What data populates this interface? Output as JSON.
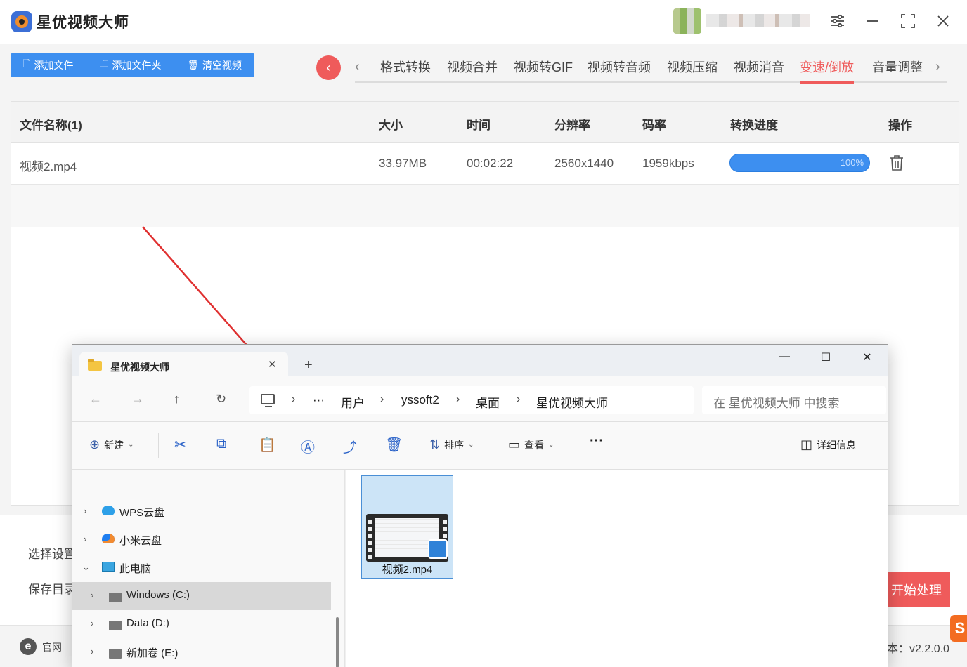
{
  "app": {
    "title": "星优视频大师",
    "toolbar": {
      "add_file": "添加文件",
      "add_folder": "添加文件夹",
      "clear_videos": "清空视频"
    },
    "tabs": [
      "格式转换",
      "视频合并",
      "视频转GIF",
      "视频转音频",
      "视频压缩",
      "视频消音",
      "变速/倒放",
      "音量调整"
    ],
    "active_tab": "变速/倒放",
    "table": {
      "headers": [
        "文件名称(1)",
        "大小",
        "时间",
        "分辨率",
        "码率",
        "转换进度",
        "操作"
      ],
      "rows": [
        {
          "name": "视频2.mp4",
          "size": "33.97MB",
          "duration": "00:02:22",
          "resolution": "2560x1440",
          "bitrate": "1959kbps",
          "progress_label": "100%",
          "progress": 100
        }
      ]
    },
    "bottom": {
      "select_settings": "选择设置",
      "save_dir": "保存目录",
      "start_button": "开始处理",
      "site_label": "官网",
      "version": "本：v2.2.0.0"
    },
    "colors": {
      "accent_blue": "#3d8ff0",
      "accent_red": "#ef5b5b"
    }
  },
  "explorer": {
    "tab_title": "星优视频大师",
    "breadcrumb": [
      "用户",
      "yssoft2",
      "桌面",
      "星优视频大师"
    ],
    "search_placeholder": "在 星优视频大师 中搜索",
    "commands": {
      "new": "新建",
      "sort": "排序",
      "view": "查看",
      "details": "详细信息"
    },
    "tree": [
      {
        "label": "WPS云盘",
        "expanded": false
      },
      {
        "label": "小米云盘",
        "expanded": false
      },
      {
        "label": "此电脑",
        "expanded": true
      },
      {
        "label": "Windows (C:)",
        "expanded": false,
        "selected": true
      },
      {
        "label": "Data (D:)",
        "expanded": false
      },
      {
        "label": "新加卷 (E:)",
        "expanded": false
      }
    ],
    "files": [
      {
        "name": "视频2.mp4",
        "selected": true
      }
    ]
  }
}
